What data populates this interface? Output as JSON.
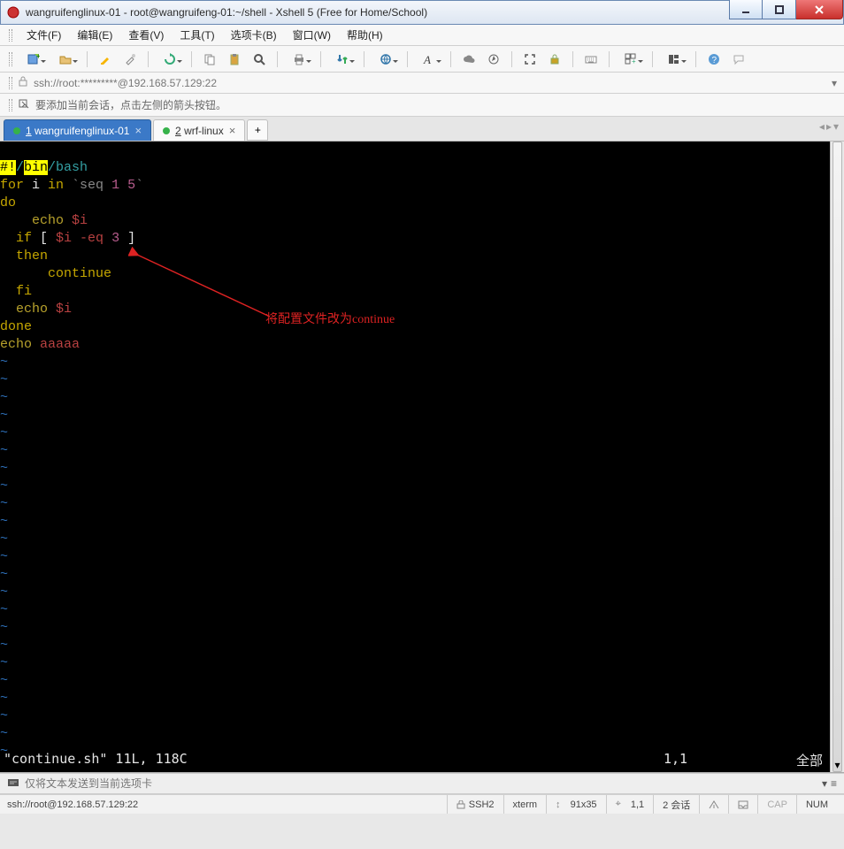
{
  "window": {
    "title": "wangruifenglinux-01 - root@wangruifeng-01:~/shell - Xshell 5 (Free for Home/School)"
  },
  "menu": {
    "file": "文件(F)",
    "edit": "编辑(E)",
    "view": "查看(V)",
    "tools": "工具(T)",
    "tabs": "选项卡(B)",
    "window": "窗口(W)",
    "help": "帮助(H)"
  },
  "address": {
    "text": "ssh://root:*********@192.168.57.129:22"
  },
  "hint": {
    "text": "要添加当前会话，点击左侧的箭头按钮。"
  },
  "tabs": {
    "items": [
      {
        "num": "1",
        "label": "wangruifenglinux-01",
        "active": true
      },
      {
        "num": "2",
        "label": "wrf-linux",
        "active": false
      }
    ]
  },
  "terminal": {
    "code": {
      "l1a": "#!",
      "l1b": "/",
      "l1c": "bin",
      "l1d": "/bash",
      "l2a": "for",
      "l2b": " i ",
      "l2c": "in",
      "l2d": " `seq ",
      "l2e": "1 5",
      "l2f": "`",
      "l3": "do",
      "l4a": "    ",
      "l4b": "echo",
      "l4c": " $i",
      "l5a": "  ",
      "l5b": "if",
      "l5c": " [ ",
      "l5d": "$i -eq",
      "l5e": " ",
      "l5f": "3",
      "l5g": " ]",
      "l6a": "  ",
      "l6b": "then",
      "l7a": "      ",
      "l7b": "continue",
      "l8a": "  ",
      "l8b": "fi",
      "l9a": "  ",
      "l9b": "echo",
      "l9c": " $i",
      "l10": "done",
      "l11a": "echo",
      "l11b": " aaaaa",
      "tilde": "~"
    },
    "status_file": "\"continue.sh\" 11L, 118C",
    "status_pos": "1,1",
    "status_all": "全部"
  },
  "annotation": {
    "text": "将配置文件改为continue"
  },
  "input": {
    "placeholder": "仅将文本发送到当前选项卡"
  },
  "statusbar": {
    "left": "ssh://root@192.168.57.129:22",
    "ssh": "SSH2",
    "term": "xterm",
    "size": "91x35",
    "pos": "1,1",
    "sessions": "2 会话",
    "cap": "CAP",
    "num": "NUM"
  }
}
